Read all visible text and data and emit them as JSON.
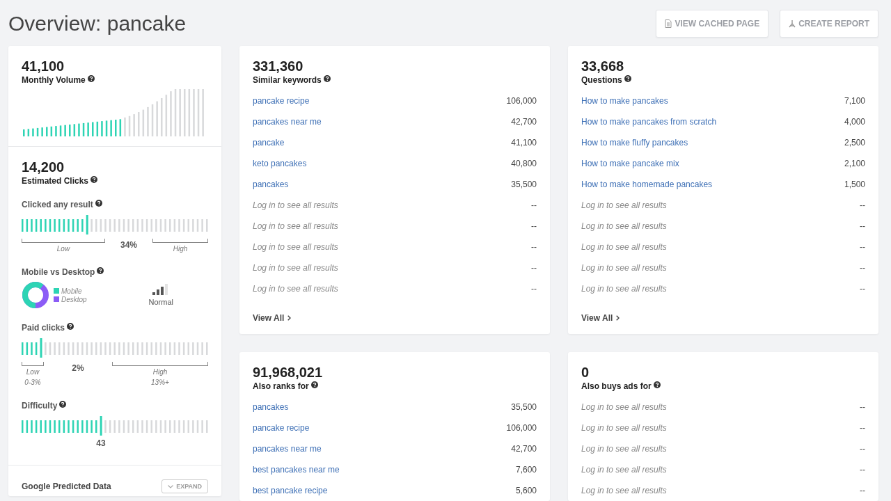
{
  "page": {
    "title": "Overview: pancake"
  },
  "actions": [
    {
      "kind": "document",
      "label": "VIEW CACHED PAGE"
    },
    {
      "kind": "pdf",
      "label": "CREATE REPORT"
    }
  ],
  "summary": {
    "volume": {
      "value": "41,100",
      "label": "Monthly Volume"
    },
    "clicks": {
      "value": "14,200",
      "label": "Estimated Clicks"
    },
    "clicked_any": {
      "label": "Clicked any result",
      "level": 0.34,
      "reading": "34%",
      "low": {
        "label": "Low"
      },
      "high": {
        "label": "High"
      }
    },
    "devices": {
      "label": "Mobile vs Desktop",
      "legend": [
        {
          "name": "Mobile",
          "color": "#2dd4b4"
        },
        {
          "name": "Desktop",
          "color": "#8b5cf6"
        }
      ],
      "traffic": "Normal"
    },
    "paid_clicks": {
      "label": "Paid clicks",
      "level": 0.1,
      "reading": "2%",
      "low": {
        "label": "Low",
        "range": "0-3%"
      },
      "high": {
        "label": "High",
        "range": "13%+"
      }
    },
    "difficulty": {
      "label": "Difficulty",
      "level": 0.43,
      "reading": "43"
    },
    "trends": {
      "label": "Google Predicted Data",
      "button": "EXPAND"
    }
  },
  "panels": [
    {
      "value": "331,360",
      "label": "Similar keywords",
      "rows": [
        {
          "kind": "link",
          "text": "pancake recipe",
          "count": "106,000"
        },
        {
          "kind": "link",
          "text": "pancakes near me",
          "count": "42,700"
        },
        {
          "kind": "link",
          "text": "pancake",
          "count": "41,100"
        },
        {
          "kind": "link",
          "text": "keto pancakes",
          "count": "40,800"
        },
        {
          "kind": "link",
          "text": "pancakes",
          "count": "35,500"
        },
        {
          "kind": "locked",
          "text": "Log in to see all results",
          "count": "--"
        },
        {
          "kind": "locked",
          "text": "Log in to see all results",
          "count": "--"
        },
        {
          "kind": "locked",
          "text": "Log in to see all results",
          "count": "--"
        },
        {
          "kind": "locked",
          "text": "Log in to see all results",
          "count": "--"
        },
        {
          "kind": "locked",
          "text": "Log in to see all results",
          "count": "--"
        }
      ],
      "view_all": "View All"
    },
    {
      "value": "33,668",
      "label": "Questions",
      "rows": [
        {
          "kind": "link",
          "text": "How to make pancakes",
          "count": "7,100"
        },
        {
          "kind": "link",
          "text": "How to make pancakes from scratch",
          "count": "4,000"
        },
        {
          "kind": "link",
          "text": "How to make fluffy pancakes",
          "count": "2,500"
        },
        {
          "kind": "link",
          "text": "How to make pancake mix",
          "count": "2,100"
        },
        {
          "kind": "link",
          "text": "How to make homemade pancakes",
          "count": "1,500"
        },
        {
          "kind": "locked",
          "text": "Log in to see all results",
          "count": "--"
        },
        {
          "kind": "locked",
          "text": "Log in to see all results",
          "count": "--"
        },
        {
          "kind": "locked",
          "text": "Log in to see all results",
          "count": "--"
        },
        {
          "kind": "locked",
          "text": "Log in to see all results",
          "count": "--"
        },
        {
          "kind": "locked",
          "text": "Log in to see all results",
          "count": "--"
        }
      ],
      "view_all": "View All"
    },
    {
      "value": "91,968,021",
      "label": "Also ranks for",
      "rows": [
        {
          "kind": "link",
          "text": "pancakes",
          "count": "35,500"
        },
        {
          "kind": "link",
          "text": "pancake recipe",
          "count": "106,000"
        },
        {
          "kind": "link",
          "text": "pancakes near me",
          "count": "42,700"
        },
        {
          "kind": "link",
          "text": "best pancakes near me",
          "count": "7,600"
        },
        {
          "kind": "link",
          "text": "best pancake recipe",
          "count": "5,600"
        }
      ]
    },
    {
      "value": "0",
      "label": "Also buys ads for",
      "rows": [
        {
          "kind": "locked",
          "text": "Log in to see all results",
          "count": "--"
        },
        {
          "kind": "locked",
          "text": "Log in to see all results",
          "count": "--"
        },
        {
          "kind": "locked",
          "text": "Log in to see all results",
          "count": "--"
        },
        {
          "kind": "locked",
          "text": "Log in to see all results",
          "count": "--"
        },
        {
          "kind": "locked",
          "text": "Log in to see all results",
          "count": "--"
        }
      ]
    }
  ]
}
